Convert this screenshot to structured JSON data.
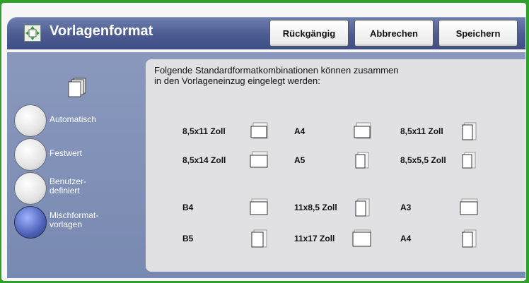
{
  "header": {
    "title": "Vorlagenformat",
    "icon": "resize-icon",
    "buttons": {
      "undo": "Rückgängig",
      "cancel": "Abbrechen",
      "save": "Speichern"
    }
  },
  "sidebar": {
    "options": [
      {
        "label": "Automatisch",
        "selected": false
      },
      {
        "label": "Festwert",
        "selected": false
      },
      {
        "label": "Benutzer-\ndefiniert",
        "selected": false
      },
      {
        "label": "Mischformat-\nvorlagen",
        "selected": true
      }
    ]
  },
  "panel": {
    "intro": "Folgende Standardformatkombinationen können zusammen\nin den Vorlageneinzug eingelegt werden:",
    "sizes": [
      {
        "label": "8,5x11 Zoll",
        "icon": "paper-lef-icon"
      },
      {
        "label": "A4",
        "icon": "paper-lef-icon"
      },
      {
        "label": "8,5x11 Zoll",
        "icon": "paper-sef-icon"
      },
      {
        "label": "8,5x14 Zoll",
        "icon": "paper-lef-icon"
      },
      {
        "label": "A5",
        "icon": "paper-sef-icon"
      },
      {
        "label": "8,5x5,5 Zoll",
        "icon": "paper-sef-icon"
      },
      {
        "label": "B4",
        "icon": "paper-lef-icon"
      },
      {
        "label": "11x8,5 Zoll",
        "icon": "paper-sef-icon"
      },
      {
        "label": "A3",
        "icon": "paper-lef-icon"
      },
      {
        "label": "B5",
        "icon": "paper-sef-icon"
      },
      {
        "label": "11x17 Zoll",
        "icon": "paper-lef-icon"
      },
      {
        "label": "A4",
        "icon": "paper-sef-icon"
      }
    ]
  }
}
